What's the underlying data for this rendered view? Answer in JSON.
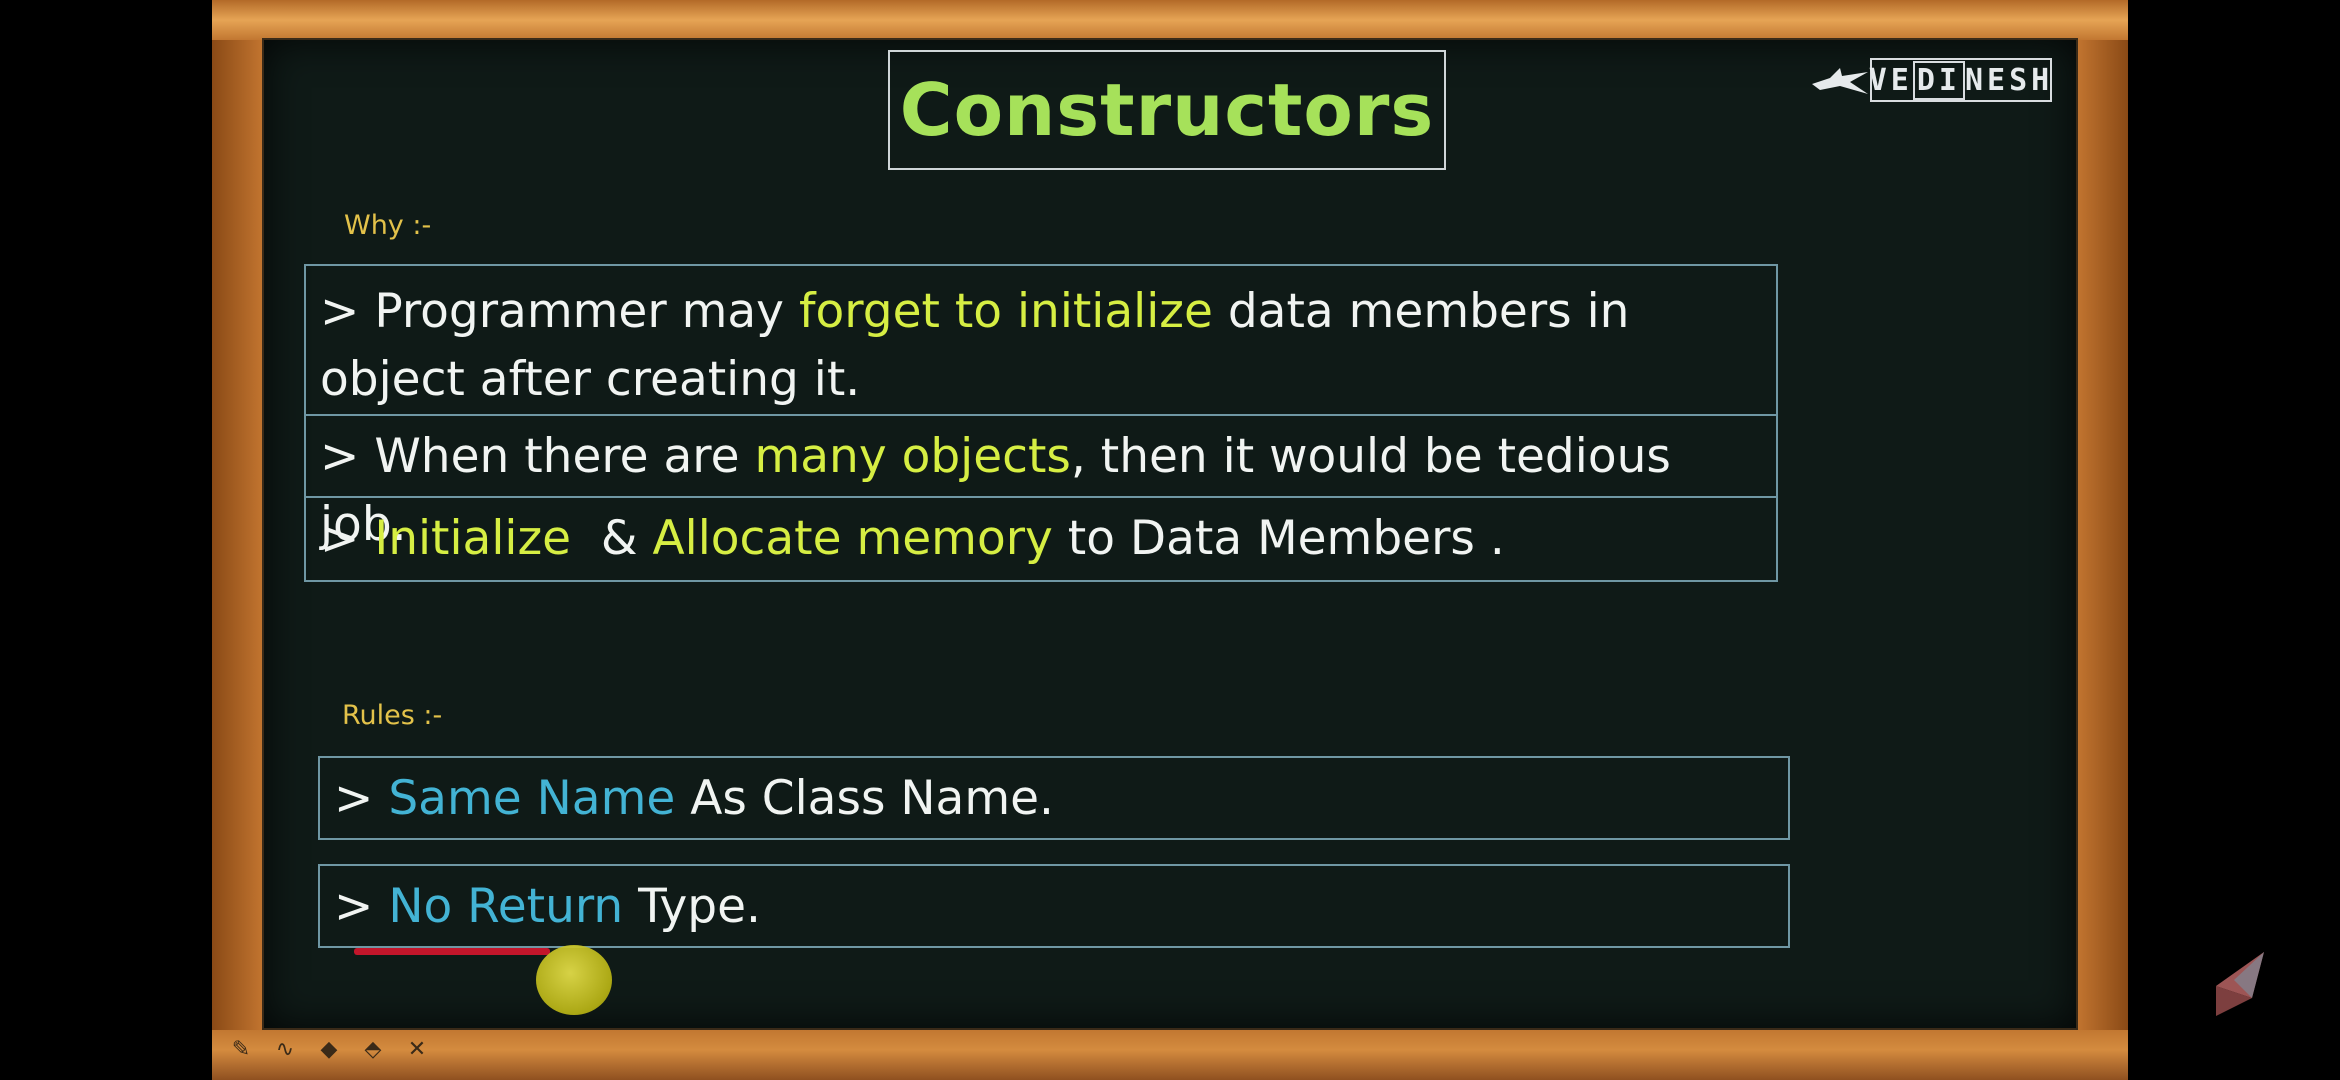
{
  "slide": {
    "title": "Constructors",
    "logo_text_pre": "VE",
    "logo_text_mid": "DI",
    "logo_text_post": "NESH",
    "why_label": "Why :-",
    "rules_label": "Rules :-",
    "why_rows": [
      {
        "prefix": "> Programmer may ",
        "highlight": "forget to initialize",
        "suffix": " data members in object after creating it."
      },
      {
        "prefix": "> When there are ",
        "highlight": "many objects",
        "suffix": ", then it would be tedious job."
      },
      {
        "prefix": "> ",
        "highlight": "Initialize",
        "mid": "  & ",
        "highlight2": "Allocate memory",
        "suffix": " to Data Members ."
      }
    ],
    "rules": [
      {
        "prefix": "> ",
        "highlight": "Same Name",
        "suffix": " As Class Name."
      },
      {
        "prefix": "> ",
        "highlight": "No Return",
        "suffix": " Type."
      }
    ]
  },
  "colors": {
    "board": "#0f1a17",
    "title": "#a6e15a",
    "highlight_green": "#d6ee43",
    "highlight_blue": "#43b3d4",
    "label": "#e3c24a",
    "frame": "#c47730",
    "underline": "#c3162b",
    "cursor": "#d8d22e"
  },
  "toolbar": {
    "icons": [
      "pen-icon",
      "curve-icon",
      "marker-icon",
      "eraser-icon",
      "pointer-icon"
    ],
    "glyphs": [
      "✎",
      "∿",
      "◆",
      "⬘",
      "✕"
    ]
  }
}
